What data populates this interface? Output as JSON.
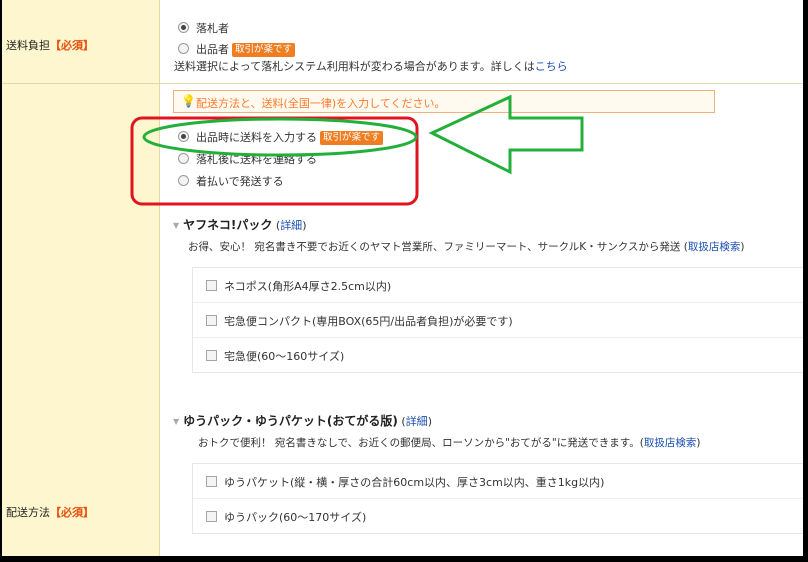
{
  "shipping_burden": {
    "label": "送料負担",
    "required": "【必須】",
    "options": [
      {
        "label": "落札者",
        "selected": true
      },
      {
        "label": "出品者",
        "badge": "取引が楽です",
        "selected": false
      }
    ],
    "note": "送料選択によって落札システム利用料が変わる場合があります。詳しくは",
    "note_link": "こちら"
  },
  "shipping_method": {
    "label": "配送方法",
    "required": "【必須】",
    "hint": "配送方法と、送料(全国一律)を入力してください。",
    "options": [
      {
        "label": "出品時に送料を入力する",
        "badge": "取引が楽です",
        "selected": true
      },
      {
        "label": "落札後に送料を連絡する",
        "selected": false
      },
      {
        "label": "着払いで発送する",
        "selected": false
      }
    ]
  },
  "yamato": {
    "title": "ヤフネコ!パック",
    "detail_link": "詳細",
    "desc": "お得、安心！ 宛名書き不要でお近くのヤマト営業所、ファミリーマート、サークルK・サンクスから発送",
    "store_link": "取扱店検索",
    "options": [
      "ネコポス(角形A4厚さ2.5cm以内)",
      "宅急便コンパクト(専用BOX(65円/出品者負担)が必要です)",
      "宅急便(60〜160サイズ)"
    ]
  },
  "yupack": {
    "title": "ゆうパック・ゆうパケット(おてがる版)",
    "detail_link": "詳細",
    "desc": "おトクで便利！ 宛名書きなしで、お近くの郵便局、ローソンから\"おてがる\"に発送できます。",
    "store_link": "取扱店検索",
    "options": [
      "ゆうパケット(縦・横・厚さの合計60cm以内、厚さ3cm以内、重さ1kg以内)",
      "ゆうパック(60〜170サイズ)"
    ]
  },
  "colors": {
    "label_bg": "#fdf6cf",
    "required": "#e8500e",
    "badge": "#ef7d22",
    "link": "#1a4fb3",
    "annotation_red": "#e0141e",
    "annotation_green": "#22b03a"
  }
}
